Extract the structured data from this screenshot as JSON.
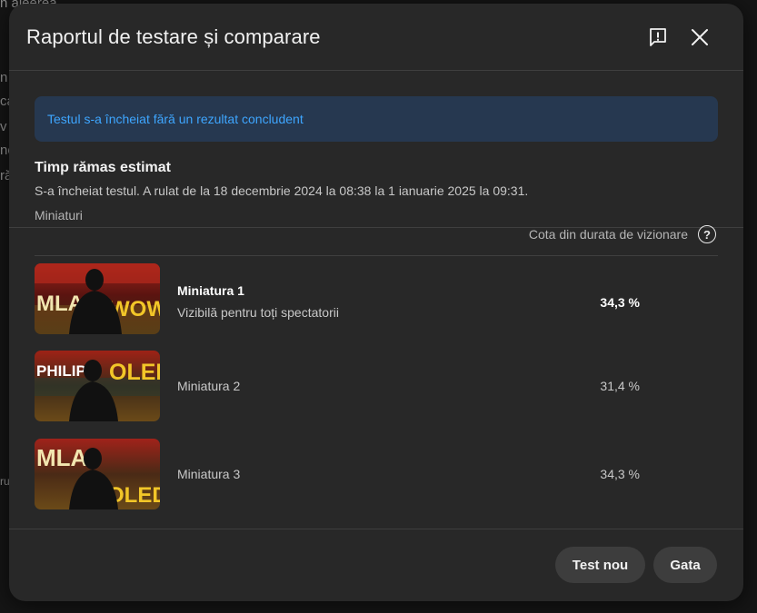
{
  "background": {
    "fragments": [
      "n aleerea",
      "n",
      "ca",
      "v",
      "no",
      "ră",
      "ru"
    ]
  },
  "dialog": {
    "title": "Raportul de testare și comparare",
    "report_icon": "report-flag-icon",
    "close_icon": "close-icon"
  },
  "banner": {
    "text": "Testul s-a încheiat fără un rezultat concludent"
  },
  "status": {
    "title": "Timp rămas estimat",
    "subtitle": "S-a încheiat testul. A rulat de la 18 decembrie 2024 la 08:38 la 1 ianuarie 2025 la 09:31."
  },
  "table": {
    "col_left": "Miniaturi",
    "col_right": "Cota din durata de vizionare",
    "help_icon": "help-circle-icon",
    "rows": [
      {
        "name": "Miniatura 1",
        "subtitle": "Vizibilă pentru toți spectatorii",
        "share": "34,3 %",
        "thumb_left_text": "MLA",
        "thumb_right_text": "WOW"
      },
      {
        "name": "Miniatura 2",
        "share": "31,4 %",
        "thumb_left_text": "PHILIPS",
        "thumb_right_text": "OLED"
      },
      {
        "name": "Miniatura 3",
        "share": "34,3 %",
        "thumb_left_text": "MLA",
        "thumb_right_text": "OLED"
      }
    ]
  },
  "footer": {
    "new_test_label": "Test nou",
    "done_label": "Gata"
  },
  "colors": {
    "dialog_bg": "#282828",
    "banner_bg": "#263850",
    "banner_text": "#3ea6ff",
    "button_bg": "#3d3d3d"
  }
}
